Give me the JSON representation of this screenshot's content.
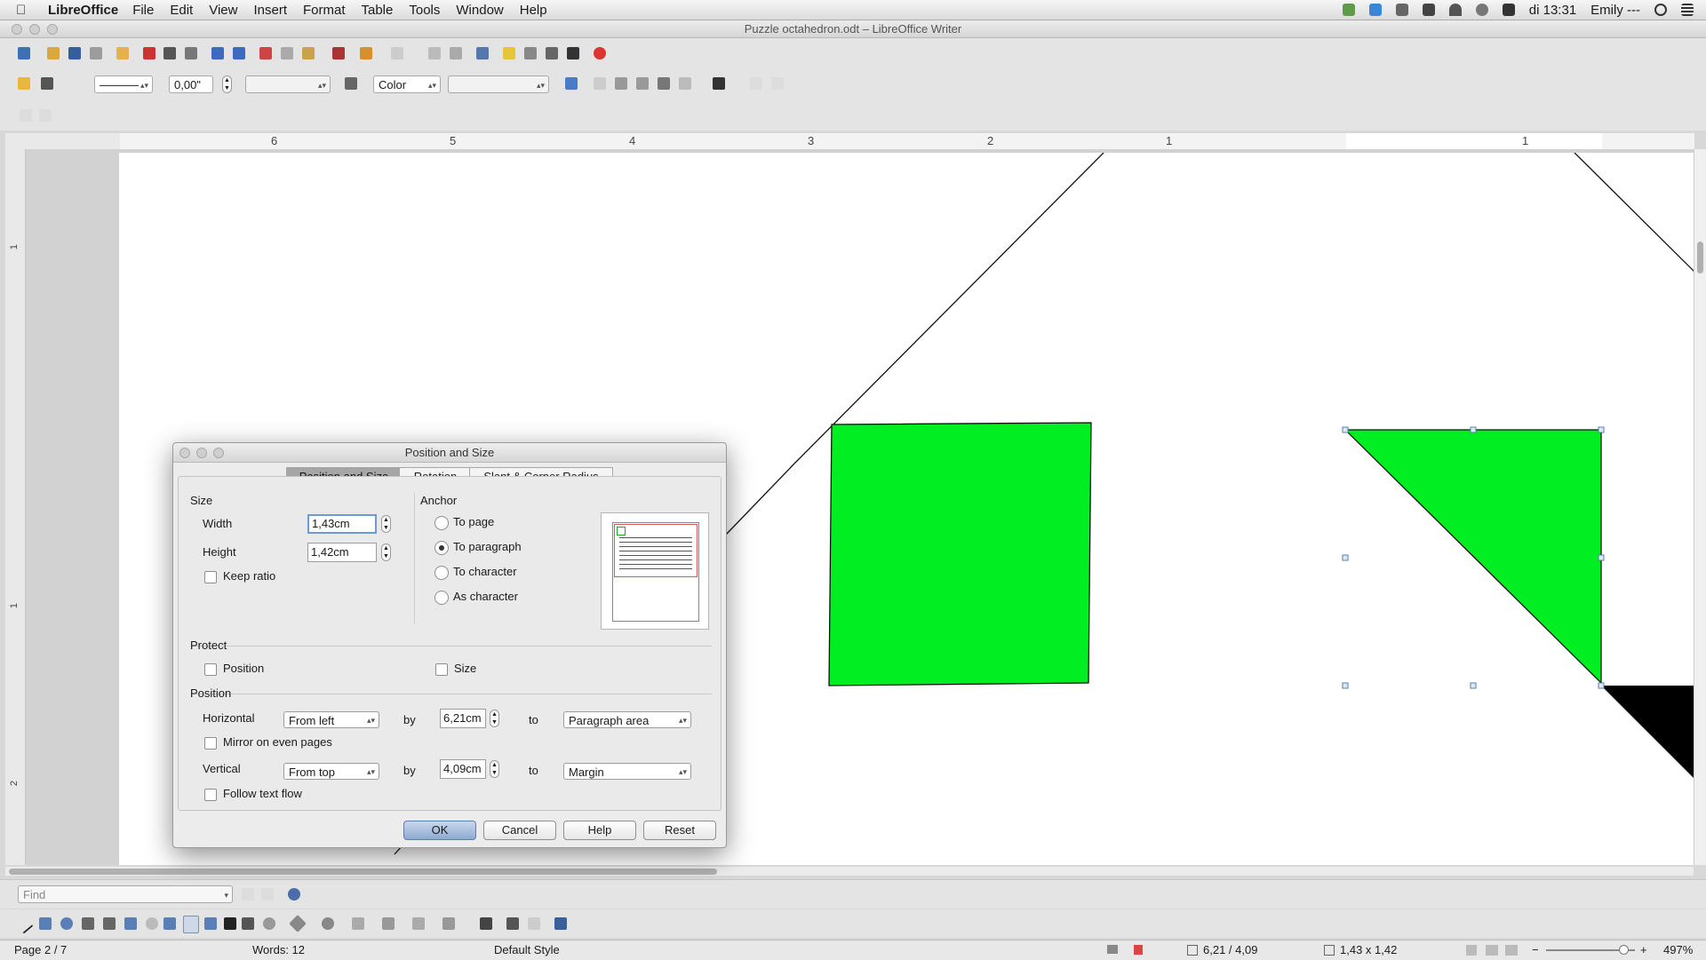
{
  "menubar": {
    "app": "LibreOffice",
    "items": [
      "File",
      "Edit",
      "View",
      "Insert",
      "Format",
      "Table",
      "Tools",
      "Window",
      "Help"
    ],
    "clock": "di 13:31",
    "user": "Emily ---"
  },
  "window": {
    "title": "Puzzle octahedron.odt – LibreOffice Writer"
  },
  "toolbar2": {
    "line_width_value": "0,00\"",
    "area_style": "Color"
  },
  "ruler": {
    "marks": [
      "6",
      "5",
      "4",
      "3",
      "2",
      "1",
      "1"
    ]
  },
  "vruler": {
    "marks": [
      "1",
      "1",
      "2"
    ]
  },
  "dialog": {
    "title": "Position and Size",
    "tabs": [
      "Position and Size",
      "Rotation",
      "Slant & Corner Radius"
    ],
    "size_label": "Size",
    "width_label": "Width",
    "width_value": "1,43cm",
    "height_label": "Height",
    "height_value": "1,42cm",
    "keep_ratio": "Keep ratio",
    "anchor_label": "Anchor",
    "anchor_options": [
      "To page",
      "To paragraph",
      "To character",
      "As character"
    ],
    "protect_label": "Protect",
    "protect_position": "Position",
    "protect_size": "Size",
    "position_label": "Position",
    "horizontal_label": "Horizontal",
    "horizontal_from": "From left",
    "by_label": "by",
    "horizontal_value": "6,21cm",
    "to_label": "to",
    "horizontal_to": "Paragraph area",
    "mirror": "Mirror on even pages",
    "vertical_label": "Vertical",
    "vertical_from": "From top",
    "vertical_value": "4,09cm",
    "vertical_to": "Margin",
    "follow": "Follow text flow",
    "buttons": {
      "ok": "OK",
      "cancel": "Cancel",
      "help": "Help",
      "reset": "Reset"
    }
  },
  "find": {
    "placeholder": "Find"
  },
  "status": {
    "page": "Page 2 / 7",
    "words": "Words: 12",
    "style": "Default Style",
    "position": "6,21 / 4,09",
    "size": "1,43 x 1,42",
    "zoom": "497%"
  },
  "colors": {
    "shape_fill": "#00ee22",
    "selection": "#5b7fb0"
  }
}
